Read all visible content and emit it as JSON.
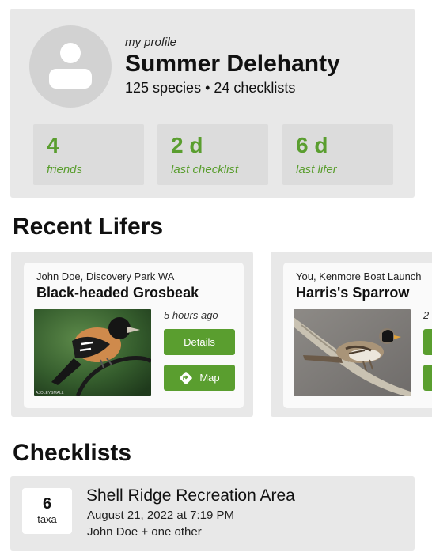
{
  "profile": {
    "subtitle": "my profile",
    "name": "Summer Delehanty",
    "summary": "125 species • 24 checklists",
    "stats": [
      {
        "value": "4",
        "label": "friends"
      },
      {
        "value": "2 d",
        "label": "last checklist"
      },
      {
        "value": "6 d",
        "label": "last lifer"
      }
    ]
  },
  "recent_lifers": {
    "title": "Recent Lifers",
    "cards": [
      {
        "location": "John Doe, Discovery Park WA",
        "species": "Black-headed Grosbeak",
        "time": "5 hours ago",
        "details_label": "Details",
        "map_label": "Map",
        "photo_credit": "AJOLEYSMALL"
      },
      {
        "location": "You, Kenmore Boat Launch",
        "species": "Harris's Sparrow",
        "time": "2",
        "details_label": "",
        "map_label": ""
      }
    ]
  },
  "checklists": {
    "title": "Checklists",
    "items": [
      {
        "taxa_count": "6",
        "taxa_label": "taxa",
        "title": "Shell Ridge Recreation Area",
        "date": "August 21, 2022 at 7:19 PM",
        "people": "John Doe + one other"
      }
    ]
  },
  "colors": {
    "accent_green": "#5a9e2f",
    "card_bg": "#e8e8e8",
    "stat_bg": "#dcdcdc"
  }
}
